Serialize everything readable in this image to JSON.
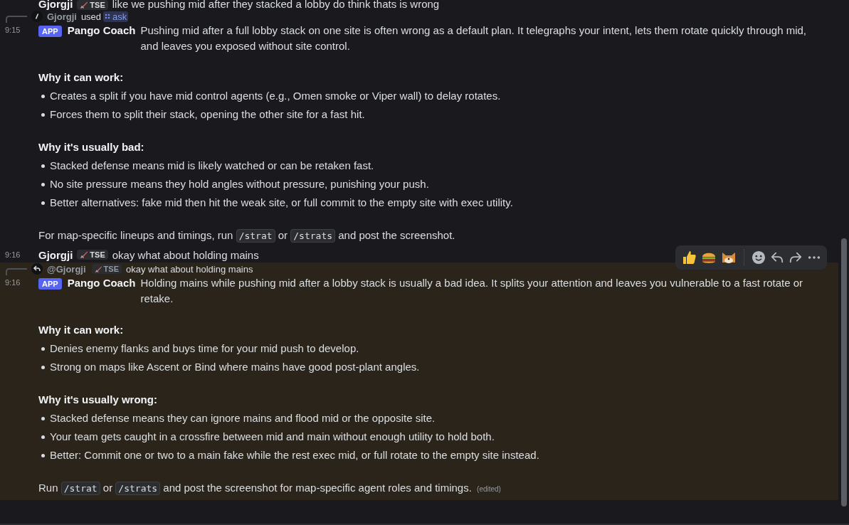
{
  "messages": [
    {
      "kind": "user",
      "author": "Gjorgji",
      "tag": "TSE",
      "text": "like we pushing mid after they stacked a lobby do think thats is wrong"
    },
    {
      "kind": "bot",
      "highlighted": false,
      "reply": {
        "kind": "command",
        "user": "Gjorgji",
        "verb": "used",
        "command": "ask"
      },
      "time": "9:15",
      "badge": "APP",
      "author": "Pango Coach",
      "blocks": [
        {
          "kind": "p",
          "parts": [
            {
              "kind": "text",
              "text": "Pushing mid after a full lobby stack on one site is often wrong as a default plan. It telegraphs your intent, lets them rotate quickly through mid, and leaves you exposed without site control."
            }
          ]
        },
        {
          "kind": "h",
          "text": "Why it can work:"
        },
        {
          "kind": "list",
          "items": [
            "Creates a split if you have mid control agents (e.g., Omen smoke or Viper wall) to delay rotates.",
            "Forces them to split their stack, opening the other site for a fast hit."
          ]
        },
        {
          "kind": "h",
          "text": "Why it's usually bad:"
        },
        {
          "kind": "list",
          "items": [
            "Stacked defense means mid is likely watched or can be retaken fast.",
            "No site pressure means they hold angles without pressure, punishing your push.",
            "Better alternatives: fake mid then hit the weak site, or full commit to the empty site with exec utility."
          ]
        },
        {
          "kind": "p",
          "parts": [
            {
              "kind": "text",
              "text": "For map-specific lineups and timings, run "
            },
            {
              "kind": "code",
              "text": "/strat"
            },
            {
              "kind": "text",
              "text": " or "
            },
            {
              "kind": "code",
              "text": "/strats"
            },
            {
              "kind": "text",
              "text": " and post the screenshot."
            }
          ]
        }
      ]
    },
    {
      "kind": "user",
      "time": "9:16",
      "author": "Gjorgji",
      "tag": "TSE",
      "text": "okay what about holding mains"
    },
    {
      "kind": "bot",
      "highlighted": true,
      "reply": {
        "kind": "message",
        "user": "@Gjorgji",
        "tag": "TSE",
        "text": "okay what about holding mains"
      },
      "time": "9:16",
      "badge": "APP",
      "author": "Pango Coach",
      "blocks": [
        {
          "kind": "p",
          "parts": [
            {
              "kind": "text",
              "text": "Holding mains while pushing mid after a lobby stack is usually a bad idea. It splits your attention and leaves you vulnerable to a fast rotate or retake."
            }
          ]
        },
        {
          "kind": "h",
          "text": "Why it can work:"
        },
        {
          "kind": "list",
          "items": [
            "Denies enemy flanks and buys time for your mid push to develop.",
            "Strong on maps like Ascent or Bind where mains have good post-plant angles."
          ]
        },
        {
          "kind": "h",
          "text": "Why it's usually wrong:"
        },
        {
          "kind": "list",
          "items": [
            "Stacked defense means they can ignore mains and flood mid or the opposite site.",
            "Your team gets caught in a crossfire between mid and main without enough utility to hold both.",
            "Better: Commit one or two to a main fake while the rest exec mid, or full rotate to the empty site instead."
          ]
        },
        {
          "kind": "p",
          "parts": [
            {
              "kind": "text",
              "text": "Run "
            },
            {
              "kind": "code",
              "text": "/strat"
            },
            {
              "kind": "text",
              "text": " or "
            },
            {
              "kind": "code",
              "text": "/strats"
            },
            {
              "kind": "text",
              "text": " and post the screenshot for map-specific agent roles and timings."
            }
          ],
          "edited": "(edited)"
        }
      ]
    }
  ]
}
